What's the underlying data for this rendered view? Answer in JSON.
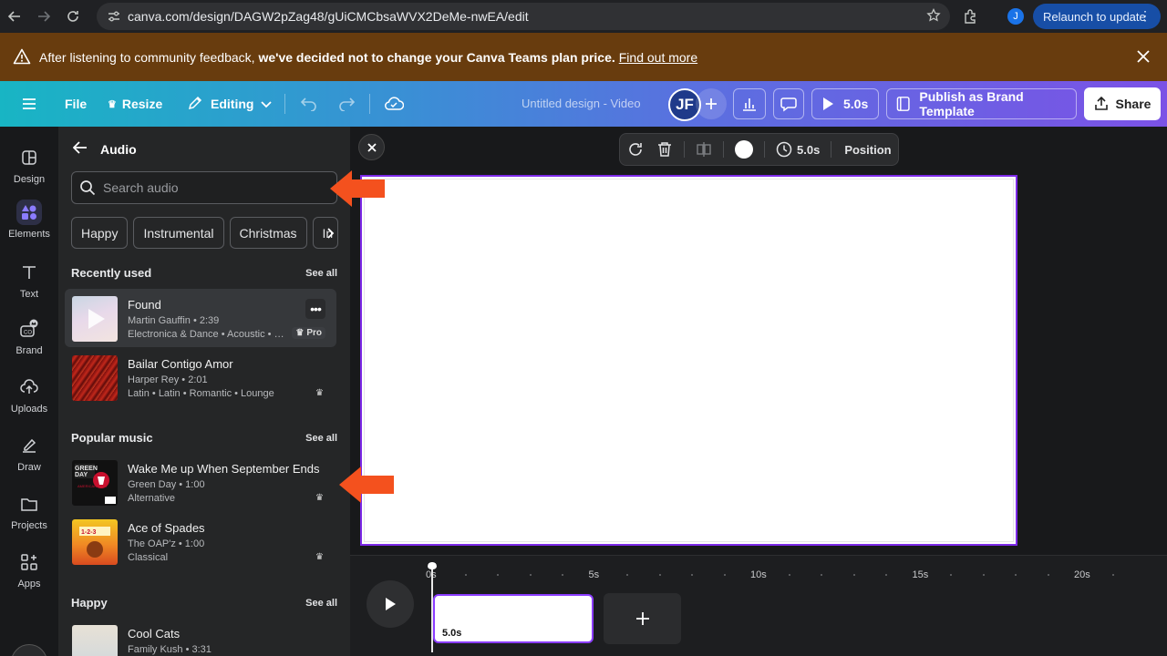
{
  "browser": {
    "url": "canva.com/design/DAGW2pZag48/gUiCMCbsaWVX2DeMe-nwEA/edit",
    "profile_initial": "J",
    "relaunch_label": "Relaunch to update"
  },
  "banner": {
    "text_prefix": "After listening to community feedback,",
    "text_bold": " we've decided not to change your Canva Teams plan price.",
    "link": "Find out more"
  },
  "toolbar": {
    "file": "File",
    "resize": "Resize",
    "editing": "Editing",
    "title": "Untitled design - Video",
    "avatar_initials": "JF",
    "duration": "5.0s",
    "publish": "Publish as Brand Template",
    "share": "Share"
  },
  "rail": {
    "items": [
      {
        "label": "Design",
        "icon": "design-icon"
      },
      {
        "label": "Elements",
        "icon": "elements-icon"
      },
      {
        "label": "Text",
        "icon": "text-icon"
      },
      {
        "label": "Brand",
        "icon": "brand-icon"
      },
      {
        "label": "Uploads",
        "icon": "uploads-icon"
      },
      {
        "label": "Draw",
        "icon": "draw-icon"
      },
      {
        "label": "Projects",
        "icon": "projects-icon"
      },
      {
        "label": "Apps",
        "icon": "apps-icon"
      }
    ]
  },
  "panel": {
    "title": "Audio",
    "search_placeholder": "Search audio",
    "chips": [
      "Happy",
      "Instrumental",
      "Christmas",
      "In"
    ],
    "sections": {
      "recent": {
        "title": "Recently used",
        "see_all": "See all"
      },
      "popular": {
        "title": "Popular music",
        "see_all": "See all"
      },
      "happy": {
        "title": "Happy",
        "see_all": "See all"
      }
    },
    "tracks": [
      {
        "title": "Found",
        "meta": "Martin Gauffin • 2:39",
        "tags": "Electronica & Dance • Acoustic • Chill",
        "badge": "Pro"
      },
      {
        "title": "Bailar Contigo Amor",
        "meta": "Harper Rey • 2:01",
        "tags": "Latin • Latin • Romantic • Lounge"
      },
      {
        "title": "Wake Me up When September Ends",
        "meta": "Green Day • 1:00",
        "tags": "Alternative"
      },
      {
        "title": "Ace of Spades",
        "meta": "The OAP'z • 1:00",
        "tags": "Classical"
      },
      {
        "title": "Cool Cats",
        "meta": "Family Kush • 3:31",
        "tags": ""
      }
    ]
  },
  "context_bar": {
    "duration": "5.0s",
    "position": "Position"
  },
  "timeline": {
    "ticks": [
      "0s",
      "5s",
      "10s",
      "15s",
      "20s"
    ],
    "clip_duration": "5.0s"
  },
  "colors": {
    "banner_bg": "#683c0e",
    "accent_purple": "#7d2ae8",
    "arrow": "#f4511e",
    "panel_bg": "#252627"
  }
}
